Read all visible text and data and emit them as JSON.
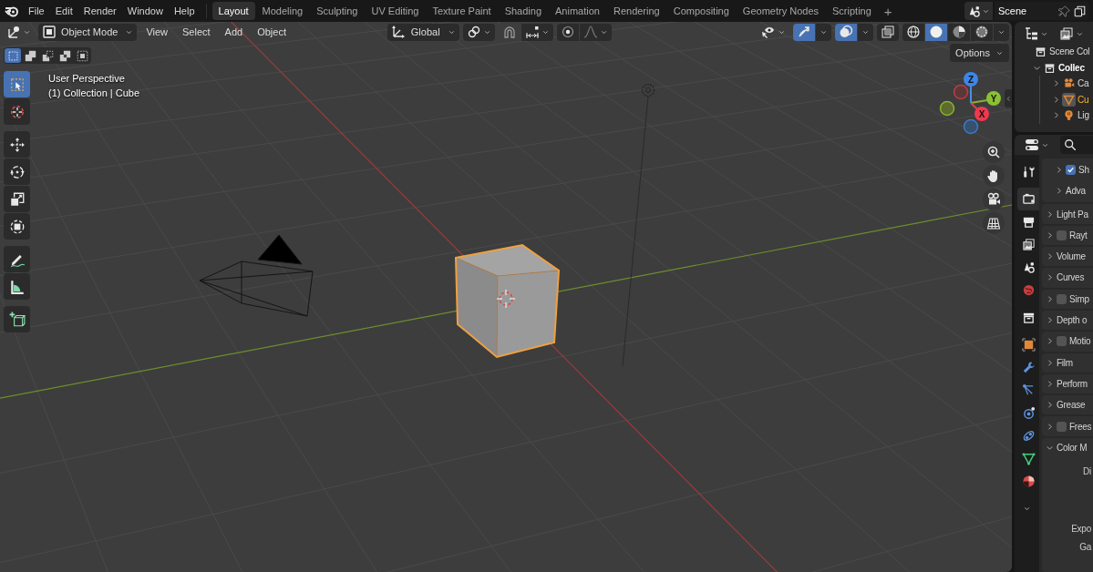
{
  "menu_bar": [
    "File",
    "Edit",
    "Render",
    "Window",
    "Help"
  ],
  "workspaces": [
    {
      "label": "Layout",
      "selected": true
    },
    {
      "label": "Modeling",
      "selected": false
    },
    {
      "label": "Sculpting",
      "selected": false
    },
    {
      "label": "UV Editing",
      "selected": false
    },
    {
      "label": "Texture Paint",
      "selected": false
    },
    {
      "label": "Shading",
      "selected": false
    },
    {
      "label": "Animation",
      "selected": false
    },
    {
      "label": "Rendering",
      "selected": false
    },
    {
      "label": "Compositing",
      "selected": false
    },
    {
      "label": "Geometry Nodes",
      "selected": false
    },
    {
      "label": "Scripting",
      "selected": false
    }
  ],
  "add_workspace": "+",
  "scene_selector": {
    "value": "Scene"
  },
  "viewport_header": {
    "mode": "Object Mode",
    "menus": [
      "View",
      "Select",
      "Add",
      "Object"
    ],
    "orientation": "Global"
  },
  "header_toggles": [
    {
      "kind": "gizmo",
      "on": true
    },
    {
      "kind": "overlay",
      "on": true
    },
    {
      "kind": "xray",
      "on": false
    }
  ],
  "shading_modes": [
    {
      "kind": "wireframe",
      "selected": false
    },
    {
      "kind": "solid",
      "selected": true
    },
    {
      "kind": "material",
      "selected": false
    },
    {
      "kind": "rendered",
      "selected": false
    }
  ],
  "select_modes": [
    {
      "kind": "new",
      "selected": true
    },
    {
      "kind": "extend",
      "selected": false
    },
    {
      "kind": "subtract",
      "selected": false
    },
    {
      "kind": "invert",
      "selected": false
    },
    {
      "kind": "intersect",
      "selected": false
    }
  ],
  "toolbar": [
    [
      {
        "kind": "select",
        "selected": true
      },
      {
        "kind": "cursor",
        "selected": false
      }
    ],
    [
      {
        "kind": "move",
        "selected": false
      },
      {
        "kind": "rotate",
        "selected": false
      },
      {
        "kind": "scale",
        "selected": false
      },
      {
        "kind": "transform",
        "selected": false
      }
    ],
    [
      {
        "kind": "annotate",
        "selected": false
      },
      {
        "kind": "measure",
        "selected": false
      }
    ],
    [
      {
        "kind": "add-cube",
        "selected": false
      }
    ]
  ],
  "view_info": {
    "title": "User Perspective",
    "context": "(1) Collection | Cube"
  },
  "options_button": "Options",
  "gizmo_axes": [
    "X",
    "Y",
    "Z"
  ],
  "outliner": {
    "root": "Scene Col",
    "items": [
      {
        "label": "Collec",
        "expanded": true,
        "children": [
          {
            "label": "Ca",
            "kind": "camera",
            "selected": false,
            "expanded": false
          },
          {
            "label": "Cu",
            "kind": "mesh",
            "selected": true,
            "expanded": false
          },
          {
            "label": "Lig",
            "kind": "light",
            "selected": false,
            "expanded": false
          }
        ]
      }
    ]
  },
  "properties_tabs": [
    [
      {
        "kind": "tool",
        "selected": false
      }
    ],
    [
      {
        "kind": "render",
        "selected": true
      },
      {
        "kind": "output",
        "selected": false
      },
      {
        "kind": "view-layer",
        "selected": false
      },
      {
        "kind": "scene",
        "selected": false
      },
      {
        "kind": "world",
        "selected": false
      }
    ],
    [
      {
        "kind": "collection",
        "selected": false
      }
    ],
    [
      {
        "kind": "object",
        "selected": false
      },
      {
        "kind": "modifiers",
        "selected": false
      },
      {
        "kind": "particles",
        "selected": false
      },
      {
        "kind": "physics",
        "selected": false
      },
      {
        "kind": "constraints",
        "selected": false
      },
      {
        "kind": "data",
        "selected": false
      },
      {
        "kind": "material",
        "selected": false
      }
    ]
  ],
  "properties_panels": [
    {
      "label": "Sh",
      "kind": "toggle-subpanel",
      "expanded": false,
      "checked": true
    },
    {
      "label": "Adva",
      "kind": "subpanel",
      "expanded": false
    },
    {
      "label": "Light Pa",
      "kind": "panel",
      "expanded": false
    },
    {
      "label": "Rayt",
      "kind": "toggle-panel",
      "expanded": false,
      "checked": false
    },
    {
      "label": "Volume",
      "kind": "panel",
      "expanded": false
    },
    {
      "label": "Curves",
      "kind": "panel",
      "expanded": false
    },
    {
      "label": "Simp",
      "kind": "toggle-panel",
      "expanded": false,
      "checked": false
    },
    {
      "label": "Depth o",
      "kind": "panel",
      "expanded": false
    },
    {
      "label": "Motio",
      "kind": "toggle-panel",
      "expanded": false,
      "checked": false
    },
    {
      "label": "Film",
      "kind": "panel",
      "expanded": false
    },
    {
      "label": "Perform",
      "kind": "panel",
      "expanded": false
    },
    {
      "label": "Grease",
      "kind": "panel",
      "expanded": false
    },
    {
      "label": "Frees",
      "kind": "toggle-panel",
      "expanded": false,
      "checked": false
    },
    {
      "label": "Color M",
      "kind": "panel",
      "expanded": true,
      "fields": [
        "Di",
        "Expo",
        "Ga"
      ]
    }
  ]
}
